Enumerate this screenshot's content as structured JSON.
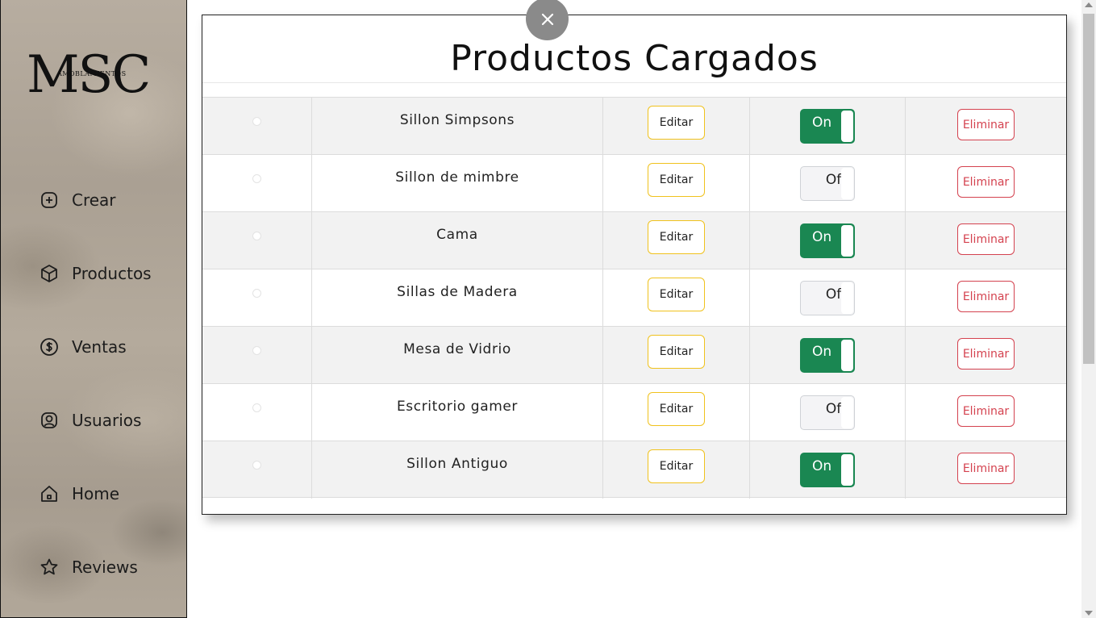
{
  "logo": {
    "letters": "MSC",
    "subtitle": "AMOBLAMIENTOS"
  },
  "sidebar": {
    "items": [
      {
        "label": "Crear",
        "icon": "plus-circle-icon"
      },
      {
        "label": "Productos",
        "icon": "box-icon"
      },
      {
        "label": "Ventas",
        "icon": "dollar-circle-icon"
      },
      {
        "label": "Usuarios",
        "icon": "user-square-icon"
      },
      {
        "label": "Home",
        "icon": "home-icon"
      },
      {
        "label": "Reviews",
        "icon": "star-icon"
      }
    ]
  },
  "panel": {
    "title": "Productos Cargados",
    "edit_label": "Editar",
    "delete_label": "Eliminar",
    "on_label": "On",
    "off_label": "Off"
  },
  "products": [
    {
      "name": "Sillon Simpsons",
      "active": true
    },
    {
      "name": "Sillon de mimbre",
      "active": false
    },
    {
      "name": "Cama",
      "active": true
    },
    {
      "name": "Sillas de Madera",
      "active": false
    },
    {
      "name": "Mesa de Vidrio",
      "active": true
    },
    {
      "name": "Escritorio gamer",
      "active": false
    },
    {
      "name": "Sillon Antiguo",
      "active": true
    }
  ],
  "colors": {
    "toggle_on": "#1a8752",
    "edit_border": "#f0c21d",
    "delete": "#d4424f"
  }
}
